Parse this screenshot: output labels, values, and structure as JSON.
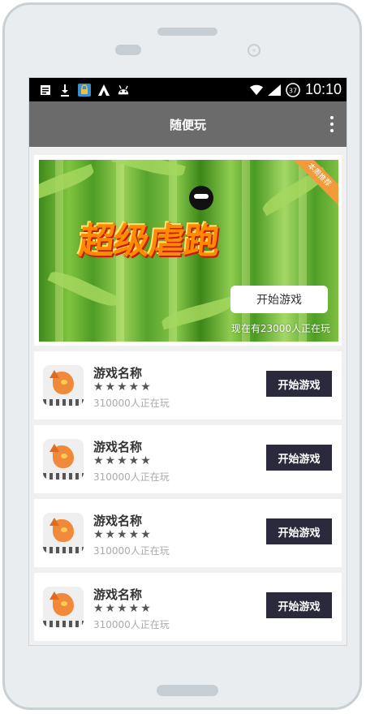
{
  "statusbar": {
    "time": "10:10",
    "battery": "37",
    "left_icons": [
      "document-icon",
      "download-icon",
      "lock-app-icon",
      "app-a-icon",
      "android-icon"
    ]
  },
  "appbar": {
    "title": "随便玩"
  },
  "banner": {
    "title": "超级虐跑",
    "ribbon": "本周推荐",
    "start_label": "开始游戏",
    "players_text": "现在有23000人正在玩"
  },
  "games": [
    {
      "name": "游戏名称",
      "stars": "★★★★★",
      "players": "310000人正在玩",
      "start_label": "开始游戏"
    },
    {
      "name": "游戏名称",
      "stars": "★★★★★",
      "players": "310000人正在玩",
      "start_label": "开始游戏"
    },
    {
      "name": "游戏名称",
      "stars": "★★★★★",
      "players": "310000人正在玩",
      "start_label": "开始游戏"
    },
    {
      "name": "游戏名称",
      "stars": "★★★★★",
      "players": "310000人正在玩",
      "start_label": "开始游戏"
    }
  ],
  "colors": {
    "appbar": "#6b6b6b",
    "start_button": "#2b2a3c",
    "ribbon": "#f39a3a"
  }
}
